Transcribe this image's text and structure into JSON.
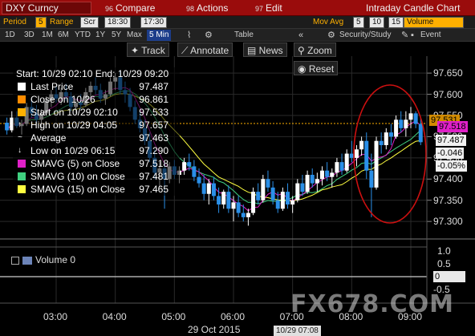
{
  "topbar": {
    "ticker": "DXY Curncy",
    "compare": {
      "num": "96",
      "label": "Compare"
    },
    "actions": {
      "num": "98",
      "label": "Actions"
    },
    "edit": {
      "num": "97",
      "label": "Edit"
    },
    "title": "Intraday Candle Chart"
  },
  "params": {
    "period_label": "Period",
    "period_value": "5",
    "range_label": "Range",
    "range_from": "Scr",
    "range_to": "18:30",
    "range_to2": "17:30",
    "movavg_label": "Mov Avg",
    "ma1": "5",
    "ma2": "10",
    "ma3": "15",
    "volume_label": "Volume"
  },
  "toolbar2": {
    "ranges": [
      "1D",
      "3D",
      "1M",
      "6M",
      "YTD",
      "1Y",
      "5Y",
      "Max"
    ],
    "interval": "5 Min",
    "table": "Table",
    "security": "Security/Study",
    "event": "Event"
  },
  "tools": {
    "track": "Track",
    "annotate": "Annotate",
    "news": "News",
    "zoom": "Zoom",
    "reset": "Reset"
  },
  "legend": {
    "header": "Start: 10/29 02:10 End: 10/29 09:20",
    "rows": [
      {
        "label": "Last Price",
        "value": "97.487",
        "color": "#ffffff"
      },
      {
        "label": "Close on 10/26",
        "value": "96.861",
        "color": "#ff8c00"
      },
      {
        "label": "Start on 10/29 02:10",
        "value": "97.533",
        "color": "#ffb000"
      },
      {
        "label": "High on 10/29 04:05",
        "value": "97.657",
        "color": "#ffffff"
      },
      {
        "label": "Average",
        "value": "97.463",
        "color": "#ffffff"
      },
      {
        "label": "Low on 10/29 06:15",
        "value": "97.290",
        "color": "#ffffff"
      },
      {
        "label": "SMAVG (5) on Close",
        "value": "97.518",
        "color": "#e020c8"
      },
      {
        "label": "SMAVG (10) on Close",
        "value": "97.481",
        "color": "#40d080"
      },
      {
        "label": "SMAVG (15) on Close",
        "value": "97.465",
        "color": "#ffff40"
      }
    ]
  },
  "price_labels": {
    "start": "97.531",
    "smavg5": "97.518",
    "last": "97.487",
    "change": "-0.046",
    "change_pct": "-0.05%"
  },
  "volume_label": "Volume",
  "volume_value": "0",
  "volume_axis": [
    "1.0",
    "0.5",
    "0",
    "-0.5"
  ],
  "x_date": "29 Oct 2015",
  "x_time_box": "10/29 07:08",
  "watermark": "FX678.COM",
  "chart_data": {
    "type": "candlestick",
    "title": "",
    "xlabel": "29 Oct 2015",
    "ylabel": "",
    "x_ticks": [
      "03:00",
      "04:00",
      "05:00",
      "06:00",
      "07:00",
      "08:00",
      "09:00"
    ],
    "y_ticks": [
      97.3,
      97.35,
      97.4,
      97.45,
      97.5,
      97.55,
      97.6,
      97.65
    ],
    "ylim": [
      97.27,
      97.69
    ],
    "grid": true,
    "up_color": "#ffffff",
    "down_color": "#2a8fe8",
    "candles": [
      {
        "t": "02:10",
        "o": 97.533,
        "h": 97.545,
        "l": 97.505,
        "c": 97.515
      },
      {
        "t": "02:15",
        "o": 97.515,
        "h": 97.56,
        "l": 97.51,
        "c": 97.545
      },
      {
        "t": "02:20",
        "o": 97.545,
        "h": 97.56,
        "l": 97.52,
        "c": 97.525
      },
      {
        "t": "02:25",
        "o": 97.525,
        "h": 97.54,
        "l": 97.505,
        "c": 97.53
      },
      {
        "t": "02:30",
        "o": 97.53,
        "h": 97.58,
        "l": 97.525,
        "c": 97.57
      },
      {
        "t": "02:35",
        "o": 97.57,
        "h": 97.59,
        "l": 97.545,
        "c": 97.555
      },
      {
        "t": "02:40",
        "o": 97.555,
        "h": 97.575,
        "l": 97.53,
        "c": 97.54
      },
      {
        "t": "02:45",
        "o": 97.54,
        "h": 97.565,
        "l": 97.52,
        "c": 97.555
      },
      {
        "t": "02:50",
        "o": 97.555,
        "h": 97.595,
        "l": 97.55,
        "c": 97.585
      },
      {
        "t": "02:55",
        "o": 97.585,
        "h": 97.61,
        "l": 97.57,
        "c": 97.6
      },
      {
        "t": "03:00",
        "o": 97.6,
        "h": 97.62,
        "l": 97.58,
        "c": 97.59
      },
      {
        "t": "03:05",
        "o": 97.59,
        "h": 97.615,
        "l": 97.575,
        "c": 97.605
      },
      {
        "t": "03:10",
        "o": 97.605,
        "h": 97.625,
        "l": 97.585,
        "c": 97.595
      },
      {
        "t": "03:15",
        "o": 97.595,
        "h": 97.605,
        "l": 97.56,
        "c": 97.57
      },
      {
        "t": "03:20",
        "o": 97.57,
        "h": 97.59,
        "l": 97.555,
        "c": 97.58
      },
      {
        "t": "03:25",
        "o": 97.58,
        "h": 97.6,
        "l": 97.565,
        "c": 97.575
      },
      {
        "t": "03:30",
        "o": 97.575,
        "h": 97.615,
        "l": 97.57,
        "c": 97.605
      },
      {
        "t": "03:35",
        "o": 97.605,
        "h": 97.63,
        "l": 97.59,
        "c": 97.62
      },
      {
        "t": "03:40",
        "o": 97.62,
        "h": 97.64,
        "l": 97.6,
        "c": 97.61
      },
      {
        "t": "03:45",
        "o": 97.61,
        "h": 97.625,
        "l": 97.58,
        "c": 97.59
      },
      {
        "t": "03:50",
        "o": 97.59,
        "h": 97.61,
        "l": 97.575,
        "c": 97.6
      },
      {
        "t": "03:55",
        "o": 97.6,
        "h": 97.64,
        "l": 97.595,
        "c": 97.63
      },
      {
        "t": "04:00",
        "o": 97.63,
        "h": 97.65,
        "l": 97.61,
        "c": 97.64
      },
      {
        "t": "04:05",
        "o": 97.64,
        "h": 97.657,
        "l": 97.6,
        "c": 97.61
      },
      {
        "t": "04:10",
        "o": 97.61,
        "h": 97.63,
        "l": 97.58,
        "c": 97.6
      },
      {
        "t": "04:15",
        "o": 97.6,
        "h": 97.615,
        "l": 97.56,
        "c": 97.57
      },
      {
        "t": "04:20",
        "o": 97.57,
        "h": 97.585,
        "l": 97.53,
        "c": 97.54
      },
      {
        "t": "04:25",
        "o": 97.54,
        "h": 97.56,
        "l": 97.51,
        "c": 97.52
      },
      {
        "t": "04:30",
        "o": 97.52,
        "h": 97.54,
        "l": 97.48,
        "c": 97.49
      },
      {
        "t": "04:35",
        "o": 97.49,
        "h": 97.51,
        "l": 97.44,
        "c": 97.45
      },
      {
        "t": "04:40",
        "o": 97.45,
        "h": 97.47,
        "l": 97.4,
        "c": 97.415
      },
      {
        "t": "04:45",
        "o": 97.415,
        "h": 97.44,
        "l": 97.38,
        "c": 97.425
      },
      {
        "t": "04:50",
        "o": 97.425,
        "h": 97.44,
        "l": 97.33,
        "c": 97.4
      },
      {
        "t": "04:55",
        "o": 97.4,
        "h": 97.44,
        "l": 97.39,
        "c": 97.43
      },
      {
        "t": "05:00",
        "o": 97.43,
        "h": 97.445,
        "l": 97.4,
        "c": 97.41
      },
      {
        "t": "05:05",
        "o": 97.41,
        "h": 97.43,
        "l": 97.39,
        "c": 97.42
      },
      {
        "t": "05:10",
        "o": 97.42,
        "h": 97.45,
        "l": 97.41,
        "c": 97.44
      },
      {
        "t": "05:15",
        "o": 97.44,
        "h": 97.46,
        "l": 97.42,
        "c": 97.43
      },
      {
        "t": "05:20",
        "o": 97.43,
        "h": 97.445,
        "l": 97.395,
        "c": 97.405
      },
      {
        "t": "05:25",
        "o": 97.405,
        "h": 97.425,
        "l": 97.38,
        "c": 97.39
      },
      {
        "t": "05:30",
        "o": 97.39,
        "h": 97.41,
        "l": 97.35,
        "c": 97.365
      },
      {
        "t": "05:35",
        "o": 97.365,
        "h": 97.4,
        "l": 97.34,
        "c": 97.39
      },
      {
        "t": "05:40",
        "o": 97.39,
        "h": 97.405,
        "l": 97.35,
        "c": 97.36
      },
      {
        "t": "05:45",
        "o": 97.36,
        "h": 97.38,
        "l": 97.32,
        "c": 97.34
      },
      {
        "t": "05:50",
        "o": 97.34,
        "h": 97.375,
        "l": 97.33,
        "c": 97.37
      },
      {
        "t": "05:55",
        "o": 97.37,
        "h": 97.385,
        "l": 97.32,
        "c": 97.33
      },
      {
        "t": "06:00",
        "o": 97.33,
        "h": 97.36,
        "l": 97.3,
        "c": 97.345
      },
      {
        "t": "06:05",
        "o": 97.345,
        "h": 97.36,
        "l": 97.31,
        "c": 97.32
      },
      {
        "t": "06:10",
        "o": 97.32,
        "h": 97.34,
        "l": 97.3,
        "c": 97.31
      },
      {
        "t": "06:15",
        "o": 97.31,
        "h": 97.33,
        "l": 97.29,
        "c": 97.32
      },
      {
        "t": "06:20",
        "o": 97.32,
        "h": 97.38,
        "l": 97.315,
        "c": 97.37
      },
      {
        "t": "06:25",
        "o": 97.37,
        "h": 97.39,
        "l": 97.34,
        "c": 97.35
      },
      {
        "t": "06:30",
        "o": 97.35,
        "h": 97.41,
        "l": 97.345,
        "c": 97.4
      },
      {
        "t": "06:35",
        "o": 97.4,
        "h": 97.42,
        "l": 97.37,
        "c": 97.38
      },
      {
        "t": "06:40",
        "o": 97.38,
        "h": 97.395,
        "l": 97.34,
        "c": 97.35
      },
      {
        "t": "06:45",
        "o": 97.35,
        "h": 97.37,
        "l": 97.32,
        "c": 97.33
      },
      {
        "t": "06:50",
        "o": 97.33,
        "h": 97.38,
        "l": 97.325,
        "c": 97.37
      },
      {
        "t": "06:55",
        "o": 97.37,
        "h": 97.39,
        "l": 97.33,
        "c": 97.34
      },
      {
        "t": "07:00",
        "o": 97.34,
        "h": 97.36,
        "l": 97.32,
        "c": 97.35
      },
      {
        "t": "07:05",
        "o": 97.35,
        "h": 97.4,
        "l": 97.345,
        "c": 97.39
      },
      {
        "t": "07:10",
        "o": 97.39,
        "h": 97.41,
        "l": 97.36,
        "c": 97.37
      },
      {
        "t": "07:15",
        "o": 97.37,
        "h": 97.42,
        "l": 97.365,
        "c": 97.41
      },
      {
        "t": "07:20",
        "o": 97.41,
        "h": 97.425,
        "l": 97.38,
        "c": 97.39
      },
      {
        "t": "07:25",
        "o": 97.39,
        "h": 97.415,
        "l": 97.37,
        "c": 97.4
      },
      {
        "t": "07:30",
        "o": 97.4,
        "h": 97.43,
        "l": 97.385,
        "c": 97.42
      },
      {
        "t": "07:35",
        "o": 97.42,
        "h": 97.44,
        "l": 97.395,
        "c": 97.405
      },
      {
        "t": "07:40",
        "o": 97.405,
        "h": 97.425,
        "l": 97.38,
        "c": 97.415
      },
      {
        "t": "07:45",
        "o": 97.415,
        "h": 97.45,
        "l": 97.405,
        "c": 97.44
      },
      {
        "t": "07:50",
        "o": 97.44,
        "h": 97.46,
        "l": 97.41,
        "c": 97.42
      },
      {
        "t": "07:55",
        "o": 97.42,
        "h": 97.47,
        "l": 97.415,
        "c": 97.46
      },
      {
        "t": "08:00",
        "o": 97.46,
        "h": 97.49,
        "l": 97.44,
        "c": 97.45
      },
      {
        "t": "08:05",
        "o": 97.45,
        "h": 97.48,
        "l": 97.43,
        "c": 97.47
      },
      {
        "t": "08:10",
        "o": 97.47,
        "h": 97.5,
        "l": 97.455,
        "c": 97.49
      },
      {
        "t": "08:15",
        "o": 97.49,
        "h": 97.51,
        "l": 97.4,
        "c": 97.42
      },
      {
        "t": "08:20",
        "o": 97.42,
        "h": 97.46,
        "l": 97.31,
        "c": 97.38
      },
      {
        "t": "08:25",
        "o": 97.38,
        "h": 97.5,
        "l": 97.375,
        "c": 97.49
      },
      {
        "t": "08:30",
        "o": 97.49,
        "h": 97.51,
        "l": 97.46,
        "c": 97.48
      },
      {
        "t": "08:35",
        "o": 97.48,
        "h": 97.52,
        "l": 97.47,
        "c": 97.51
      },
      {
        "t": "08:40",
        "o": 97.51,
        "h": 97.53,
        "l": 97.48,
        "c": 97.5
      },
      {
        "t": "08:45",
        "o": 97.5,
        "h": 97.55,
        "l": 97.495,
        "c": 97.54
      },
      {
        "t": "08:50",
        "o": 97.54,
        "h": 97.56,
        "l": 97.51,
        "c": 97.52
      },
      {
        "t": "08:55",
        "o": 97.52,
        "h": 97.56,
        "l": 97.5,
        "c": 97.54
      },
      {
        "t": "09:00",
        "o": 97.54,
        "h": 97.57,
        "l": 97.52,
        "c": 97.555
      },
      {
        "t": "09:05",
        "o": 97.555,
        "h": 97.56,
        "l": 97.52,
        "c": 97.53
      },
      {
        "t": "09:10",
        "o": 97.53,
        "h": 97.545,
        "l": 97.48,
        "c": 97.487
      }
    ],
    "series": [
      {
        "name": "SMAVG (5) on Close",
        "color": "#e020c8"
      },
      {
        "name": "SMAVG (10) on Close",
        "color": "#40d080"
      },
      {
        "name": "SMAVG (15) on Close",
        "color": "#ffff40"
      }
    ],
    "reference_lines": [
      {
        "name": "Start on 10/29 02:10",
        "value": 97.531,
        "color": "#ffb000",
        "style": "dotted"
      }
    ],
    "annotations": [
      {
        "type": "ellipse",
        "color": "#cc1010",
        "around": "08:00-09:10"
      }
    ]
  }
}
